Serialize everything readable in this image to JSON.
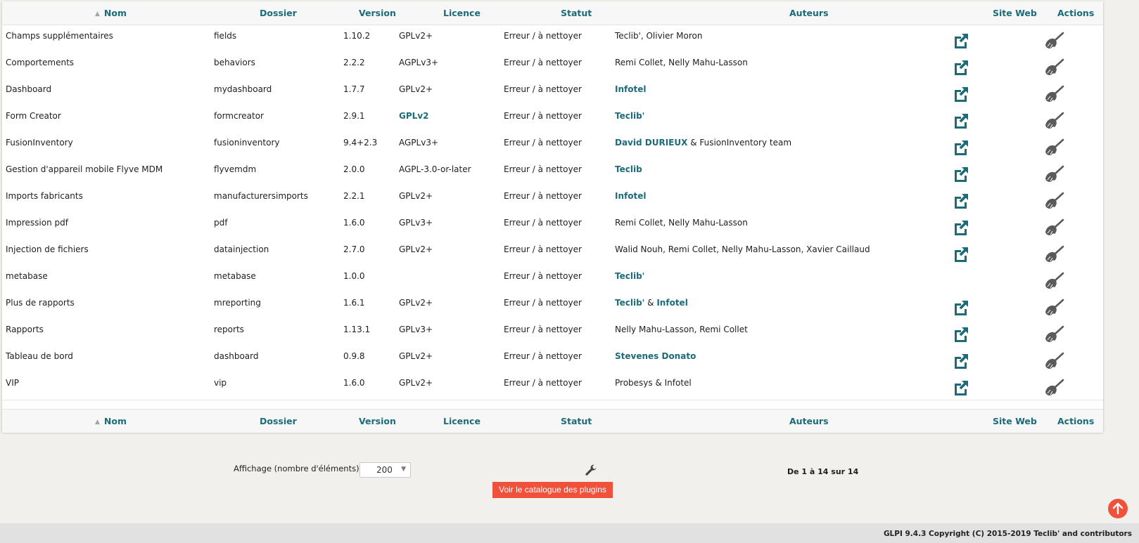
{
  "columns": {
    "nom": "Nom",
    "dossier": "Dossier",
    "version": "Version",
    "licence": "Licence",
    "statut": "Statut",
    "auteurs": "Auteurs",
    "site_web": "Site Web",
    "actions": "Actions"
  },
  "rows": [
    {
      "nom": "Champs supplémentaires",
      "dossier": "fields",
      "version": "1.10.2",
      "licence": "GPLv2+",
      "statut": "Erreur / à nettoyer",
      "auteurs": [
        {
          "t": "Teclib', Olivier Moron"
        }
      ],
      "web": true
    },
    {
      "nom": "Comportements",
      "dossier": "behaviors",
      "version": "2.2.2",
      "licence": "AGPLv3+",
      "statut": "Erreur / à nettoyer",
      "auteurs": [
        {
          "t": "Remi Collet, Nelly Mahu-Lasson"
        }
      ],
      "web": true
    },
    {
      "nom": "Dashboard",
      "dossier": "mydashboard",
      "version": "1.7.7",
      "licence": "GPLv2+",
      "statut": "Erreur / à nettoyer",
      "auteurs": [
        {
          "t": "Infotel",
          "link": true
        }
      ],
      "web": true
    },
    {
      "nom": "Form Creator",
      "dossier": "formcreator",
      "version": "2.9.1",
      "licence": "GPLv2",
      "licence_link": true,
      "statut": "Erreur / à nettoyer",
      "auteurs": [
        {
          "t": "Teclib'",
          "link": true
        }
      ],
      "web": true
    },
    {
      "nom": "FusionInventory",
      "dossier": "fusioninventory",
      "version": "9.4+2.3",
      "licence": "AGPLv3+",
      "statut": "Erreur / à nettoyer",
      "auteurs": [
        {
          "t": "David DURIEUX",
          "link": true
        },
        {
          "t": " & FusionInventory team"
        }
      ],
      "web": true
    },
    {
      "nom": "Gestion d'appareil mobile Flyve MDM",
      "dossier": "flyvemdm",
      "version": "2.0.0",
      "licence": "AGPL-3.0-or-later",
      "statut": "Erreur / à nettoyer",
      "auteurs": [
        {
          "t": "Teclib",
          "link": true
        }
      ],
      "web": true
    },
    {
      "nom": "Imports fabricants",
      "dossier": "manufacturersimports",
      "version": "2.2.1",
      "licence": "GPLv2+",
      "statut": "Erreur / à nettoyer",
      "auteurs": [
        {
          "t": "Infotel",
          "link": true
        }
      ],
      "web": true
    },
    {
      "nom": "Impression pdf",
      "dossier": "pdf",
      "version": "1.6.0",
      "licence": "GPLv3+",
      "statut": "Erreur / à nettoyer",
      "auteurs": [
        {
          "t": "Remi Collet, Nelly Mahu-Lasson"
        }
      ],
      "web": true
    },
    {
      "nom": "Injection de fichiers",
      "dossier": "datainjection",
      "version": "2.7.0",
      "licence": "GPLv2+",
      "statut": "Erreur / à nettoyer",
      "auteurs": [
        {
          "t": "Walid Nouh, Remi Collet, Nelly Mahu-Lasson, Xavier Caillaud"
        }
      ],
      "web": true
    },
    {
      "nom": "metabase",
      "dossier": "metabase",
      "version": "1.0.0",
      "licence": "",
      "statut": "Erreur / à nettoyer",
      "auteurs": [
        {
          "t": "Teclib'",
          "link": true
        }
      ],
      "web": false
    },
    {
      "nom": "Plus de rapports",
      "dossier": "mreporting",
      "version": "1.6.1",
      "licence": "GPLv2+",
      "statut": "Erreur / à nettoyer",
      "auteurs": [
        {
          "t": "Teclib'",
          "link": true
        },
        {
          "t": " & "
        },
        {
          "t": "Infotel",
          "link": true
        }
      ],
      "web": true
    },
    {
      "nom": "Rapports",
      "dossier": "reports",
      "version": "1.13.1",
      "licence": "GPLv3+",
      "statut": "Erreur / à nettoyer",
      "auteurs": [
        {
          "t": "Nelly Mahu-Lasson, Remi Collet"
        }
      ],
      "web": true
    },
    {
      "nom": "Tableau de bord",
      "dossier": "dashboard",
      "version": "0.9.8",
      "licence": "GPLv2+",
      "statut": "Erreur / à nettoyer",
      "auteurs": [
        {
          "t": "Stevenes Donato",
          "link": true
        }
      ],
      "web": true
    },
    {
      "nom": "VIP",
      "dossier": "vip",
      "version": "1.6.0",
      "licence": "GPLv2+",
      "statut": "Erreur / à nettoyer",
      "auteurs": [
        {
          "t": "Probesys & Infotel"
        }
      ],
      "web": true
    }
  ],
  "display_label": "Affichage (nombre d'éléments)",
  "display_count": "200",
  "catalog_button": "Voir le catalogue des plugins",
  "pager_text": "De 1 à 14 sur 14",
  "copyright": "GLPI 9.4.3 Copyright (C) 2015-2019 Teclib' and contributors",
  "colors": {
    "link": "#1b6b7b",
    "accent": "#f0513b",
    "icon": "#1b6b7b",
    "broom": "#5a5a5a"
  },
  "icons": {
    "website": "external-link-icon",
    "action": "broom-icon",
    "settings": "wrench-icon",
    "to_top": "arrow-up-icon",
    "sort": "sort-asc-icon"
  }
}
